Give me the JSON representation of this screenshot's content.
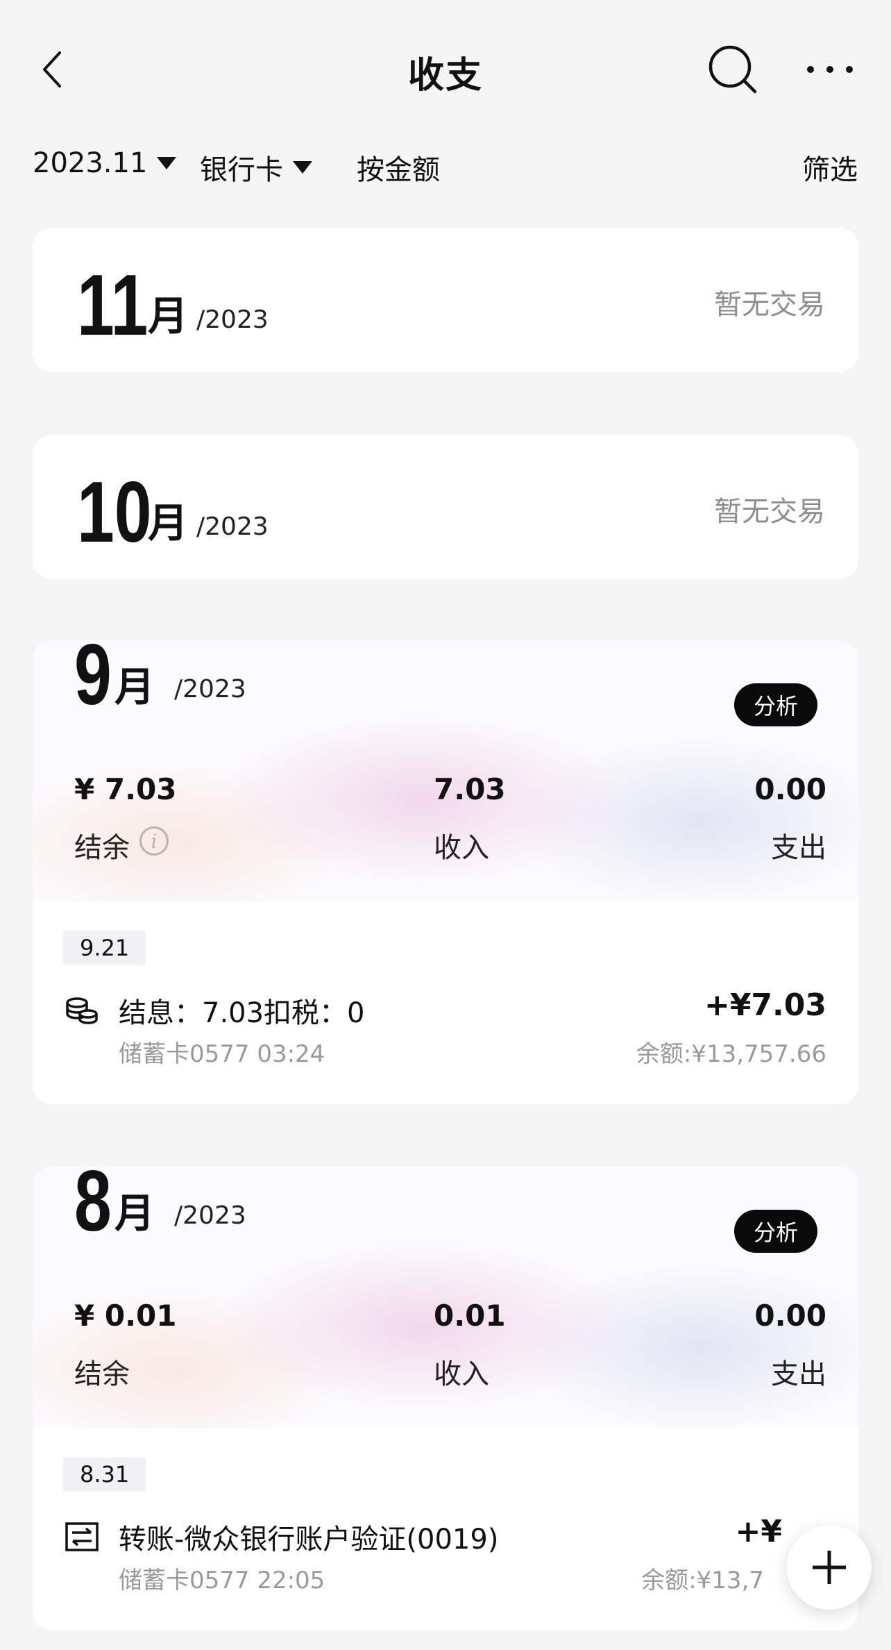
{
  "header": {
    "title": "收支"
  },
  "filters": {
    "month": "2023.11",
    "account": "银行卡",
    "sort": "按金额",
    "filter": "筛选"
  },
  "months": [
    {
      "month_num": "11",
      "month_char": "月",
      "year": "/2023",
      "empty_text": "暂无交易"
    },
    {
      "month_num": "10",
      "month_char": "月",
      "year": "/2023",
      "empty_text": "暂无交易"
    },
    {
      "month_num": "9",
      "month_char": "月",
      "year": "/2023",
      "analyze_label": "分析",
      "balance": "¥ 7.03",
      "balance_label": "结余",
      "income": "7.03",
      "income_label": "收入",
      "expense": "0.00",
      "expense_label": "支出",
      "date": "9.21",
      "tx_icon": "coins-icon",
      "tx_title": "结息：7.03扣税：0",
      "tx_sub": "储蓄卡0577 03:24",
      "tx_amount": "+¥7.03",
      "tx_balance": "余额:¥13,757.66"
    },
    {
      "month_num": "8",
      "month_char": "月",
      "year": "/2023",
      "analyze_label": "分析",
      "balance": "¥ 0.01",
      "balance_label": "结余",
      "income": "0.01",
      "income_label": "收入",
      "expense": "0.00",
      "expense_label": "支出",
      "date": "8.31",
      "tx_icon": "transfer-icon",
      "tx_title": "转账-微众银行账户验证(0019)",
      "tx_sub": "储蓄卡0577 22:05",
      "tx_amount": "+¥",
      "tx_balance": "余额:¥13,7"
    }
  ]
}
